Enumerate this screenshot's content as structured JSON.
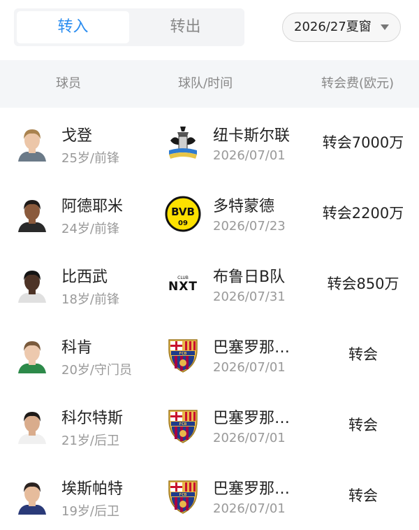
{
  "tabs": [
    {
      "label": "转入",
      "active": true
    },
    {
      "label": "转出",
      "active": false
    }
  ],
  "window_select": {
    "value": "2026/27夏窗"
  },
  "table": {
    "headers": [
      "球员",
      "球队/时间",
      "转会费(欧元)"
    ]
  },
  "rows": [
    {
      "player": "戈登",
      "info": "25岁/前锋",
      "club": "纽卡斯尔联",
      "date": "2026/07/01",
      "fee": "转会7000万",
      "club_logo": "newcastle-crest"
    },
    {
      "player": "阿德耶米",
      "info": "24岁/前锋",
      "club": "多特蒙德",
      "date": "2026/07/23",
      "fee": "转会2200万",
      "club_logo": "bvb-crest"
    },
    {
      "player": "比西武",
      "info": "18岁/前锋",
      "club": "布鲁日B队",
      "date": "2026/07/31",
      "fee": "转会850万",
      "club_logo": "club-nxt-logo",
      "logo_text": "NXT",
      "logo_small": "CLUB"
    },
    {
      "player": "科肯",
      "info": "20岁/守门员",
      "club": "巴塞罗那…",
      "date": "2026/07/01",
      "fee": "转会",
      "club_logo": "fcb-crest"
    },
    {
      "player": "科尔特斯",
      "info": "21岁/后卫",
      "club": "巴塞罗那…",
      "date": "2026/07/01",
      "fee": "转会",
      "club_logo": "fcb-crest"
    },
    {
      "player": "埃斯帕特",
      "info": "19岁/后卫",
      "club": "巴塞罗那…",
      "date": "2026/07/01",
      "fee": "转会",
      "club_logo": "fcb-crest"
    }
  ],
  "colors": {
    "accent": "#2b8df0",
    "header_bg": "#f4f6f8",
    "muted_text": "#999999"
  }
}
